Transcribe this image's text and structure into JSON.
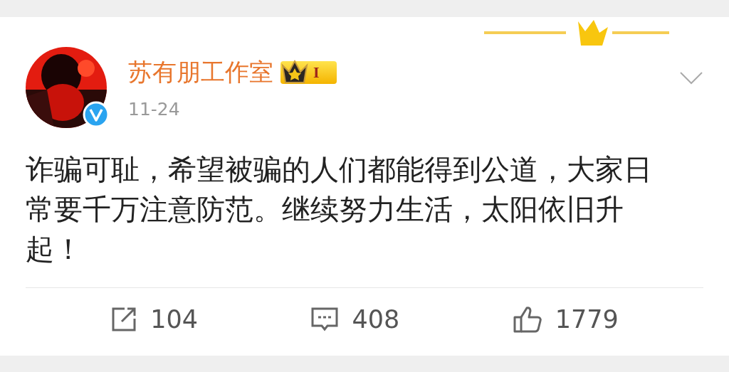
{
  "post": {
    "author": "苏有朋工作室",
    "level_badge": "I",
    "verified": true,
    "date": "11-24",
    "text": "诈骗可耻，希望被骗的人们都能得到公道，大家日常要千万注意防范。继续努力生活，太阳依旧升起！"
  },
  "actions": [
    {
      "kind": "repost",
      "count": "104"
    },
    {
      "kind": "comment",
      "count": "408"
    },
    {
      "kind": "like",
      "count": "1779"
    }
  ]
}
